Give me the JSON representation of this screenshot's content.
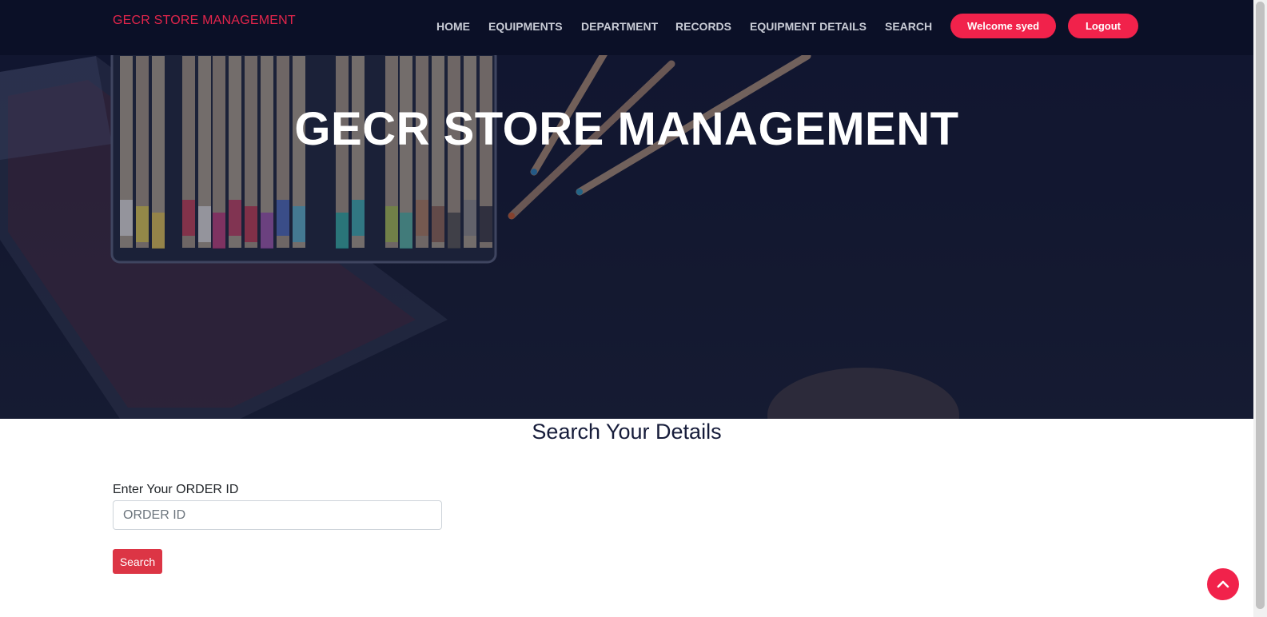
{
  "navbar": {
    "brand": "GECR STORE MANAGEMENT",
    "links": [
      "HOME",
      "EQUIPMENTS",
      "DEPARTMENT",
      "RECORDS",
      "EQUIPMENT DETAILS",
      "SEARCH"
    ],
    "welcome_label": "Welcome syed",
    "logout_label": "Logout"
  },
  "hero": {
    "title": "GECR STORE MANAGEMENT"
  },
  "search_form": {
    "heading": "Search Your Details",
    "label": "Enter Your ORDER ID",
    "placeholder": "ORDER ID",
    "value": "",
    "button_label": "Search"
  },
  "colors": {
    "accent": "#f1224b",
    "navbar": "#0b1027",
    "button": "#dc3545"
  },
  "icons": {
    "back_to_top": "chevron-up-icon"
  }
}
